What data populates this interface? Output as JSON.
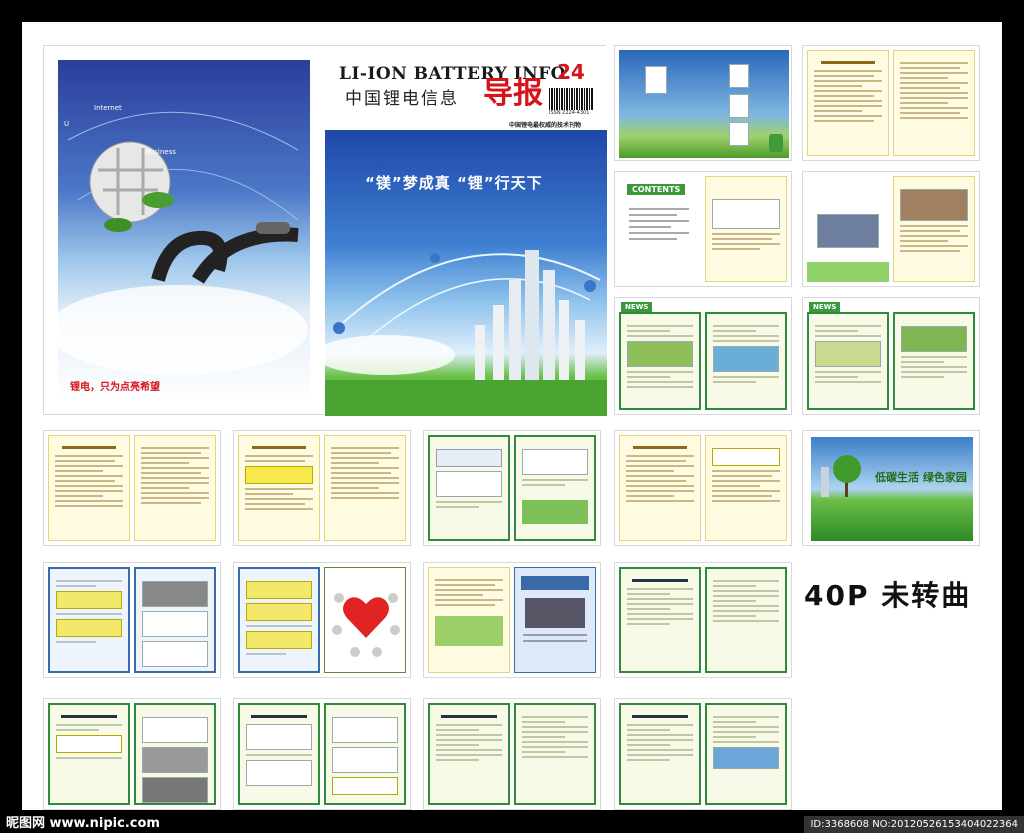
{
  "cover": {
    "tagline": "锂电，只为点亮希望",
    "orbit_label_1": "Internet",
    "orbit_label_2": "U",
    "orbit_label_3": "Business",
    "title_en": "LI-ION BATTERY INFO.",
    "title_cn": "中国锂电信息",
    "title_red": "导报",
    "issue_no": "24",
    "issn": "ISSN 2224-4301",
    "sub_line": "中国锂电最权威的技术刊物",
    "slogan": "“镁”梦成真  “锂”行天下"
  },
  "spread_tags": {
    "contents": "CONTENTS",
    "news": "NEWS",
    "green_banner": "低碳生活 绿色家园",
    "green_banner_sub": "低碳生活 绿色家园"
  },
  "label_40p": "40P 未转曲",
  "watermark": {
    "left": "昵图网 www.nipic.com",
    "right": "ID:3368608 NO:20120526153404022364"
  },
  "colors": {
    "green_frame": "#2e8b3a",
    "yellow_page": "#fffbe0",
    "blue_frame": "#3a6aa8",
    "red_logo": "#d7141b"
  }
}
